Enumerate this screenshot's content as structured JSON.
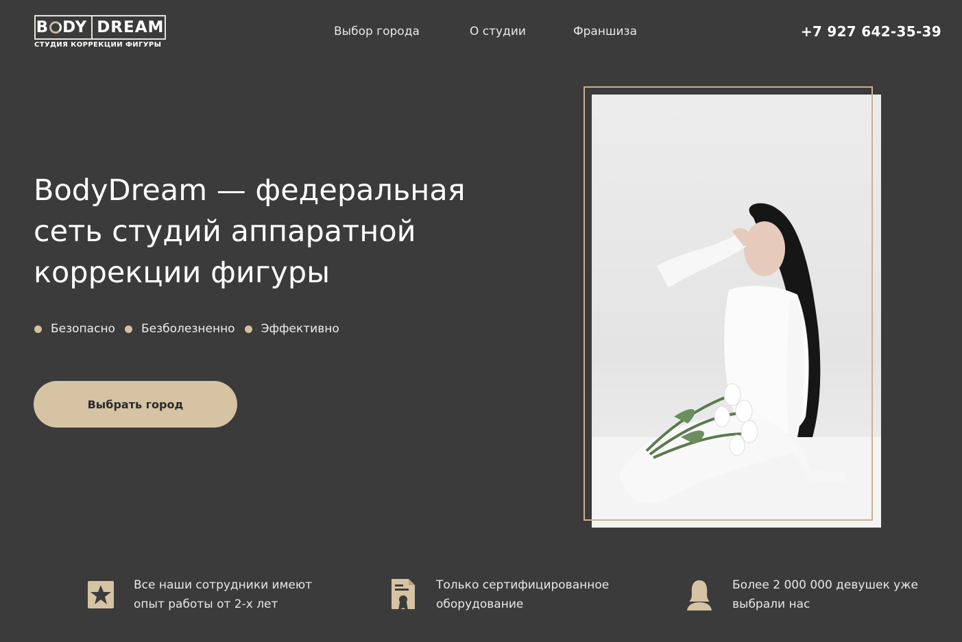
{
  "brand": {
    "logo_left": "B",
    "logo_left_rest": "DY",
    "logo_right": "DREAM",
    "logo_subtitle": "СТУДИЯ КОРРЕКЦИИ ФИГУРЫ"
  },
  "nav": {
    "items": [
      {
        "label": "Выбор города"
      },
      {
        "label": "О студии"
      },
      {
        "label": "Франшиза"
      }
    ]
  },
  "header": {
    "phone": "+7 927 642-35-39"
  },
  "hero": {
    "title": "BodyDream — федеральная сеть студий аппаратной коррекции фигуры",
    "bullets": [
      "Безопасно",
      "Безболезненно",
      "Эффективно"
    ],
    "cta_label": "Выбрать город"
  },
  "features": [
    {
      "icon": "star-badge-icon",
      "text": "Все наши сотрудники имеют опыт работы от 2-х лет"
    },
    {
      "icon": "certificate-document-icon",
      "text": "Только сертифицированное оборудование"
    },
    {
      "icon": "woman-silhouette-icon",
      "text": "Более 2 000 000 девушек уже выбрали нас"
    }
  ],
  "colors": {
    "background": "#3b3b3b",
    "accent": "#d5c3a4",
    "frame": "#c9b28f"
  }
}
